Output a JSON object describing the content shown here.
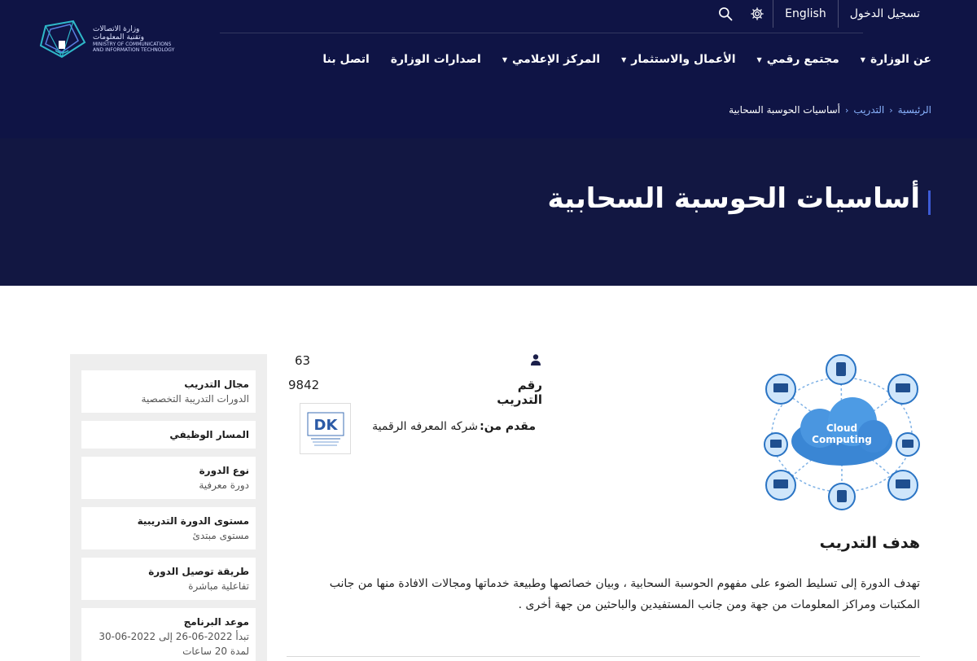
{
  "topbar": {
    "login": "تسجيل الدخول",
    "language": "English"
  },
  "logo": {
    "ar_line1": "وزارة الاتصالات",
    "ar_line2": "وتقنية المعلومات",
    "en_line1": "MINISTRY OF COMMUNICATIONS",
    "en_line2": "AND INFORMATION TECHNOLOGY"
  },
  "nav": {
    "items": [
      {
        "label": "عن الوزارة",
        "dropdown": true
      },
      {
        "label": "مجتمع رقمي",
        "dropdown": true
      },
      {
        "label": "الأعمال والاستثمار",
        "dropdown": true
      },
      {
        "label": "المركز الإعلامي",
        "dropdown": true
      },
      {
        "label": "اصدارات الوزارة",
        "dropdown": false
      },
      {
        "label": "اتصل بنا",
        "dropdown": false
      }
    ]
  },
  "breadcrumb": {
    "home": "الرئيسية",
    "training": "التدريب",
    "current": "أساسيات الحوسبة السحابية"
  },
  "page": {
    "title": "أساسيات الحوسبة السحابية"
  },
  "sidebar": {
    "cards": [
      {
        "key": "مجال التدريب",
        "value": "الدورات التدريبة التخصصية"
      },
      {
        "key": "المسار الوظيفي",
        "value": ""
      },
      {
        "key": "نوع الدورة",
        "value": "دورة معرفية"
      },
      {
        "key": "مستوى الدورة التدريبية",
        "value": "مستوى مبتدئ"
      },
      {
        "key": "طريقة توصيل الدورة",
        "value": "تفاعلية مباشرة"
      },
      {
        "key": "موعد البرنامج",
        "value": "تبدأ 2022-06-26 إلى 2022-06-30",
        "value2": "لمدة 20 ساعات"
      }
    ]
  },
  "course": {
    "participants": "63",
    "number_label": "رقم التدريب",
    "number_value": "9842",
    "provider_label": "مقدم من:",
    "provider_name": "شركه المعرفه الرقمية",
    "provider_logo_text": "DK",
    "image_label_1": "Cloud",
    "image_label_2": "Computing",
    "goal_title": "هدف التدريب",
    "goal_text": "تهدف الدورة إلى تسليط الضوء على مفهوم الحوسبة السحابية ، وبيان خصائصها وطبيعة خدماتها ومجالات الافادة منها من جانب المكتبات ومراكز المعلومات من جهة ومن جانب المستفيدين والباحثين من جهة أخرى ."
  },
  "colors": {
    "header_bg": "#0f1445",
    "hero_bg": "#121742",
    "accent": "#3d5bd6",
    "link": "#8ab4ff",
    "sidebar_bg": "#eeeeee"
  }
}
